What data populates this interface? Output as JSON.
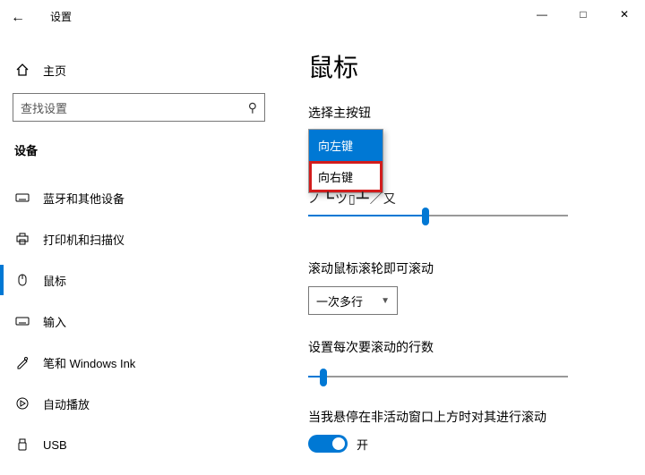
{
  "window": {
    "title": "设置"
  },
  "sidebar": {
    "home": "主页",
    "search_placeholder": "查找设置",
    "category": "设备",
    "items": [
      {
        "icon": "keyboard-icon",
        "label": "蓝牙和其他设备"
      },
      {
        "icon": "printer-icon",
        "label": "打印机和扫描仪"
      },
      {
        "icon": "mouse-icon",
        "label": "鼠标"
      },
      {
        "icon": "keyboard2-icon",
        "label": "输入"
      },
      {
        "icon": "pen-icon",
        "label": "笔和 Windows Ink"
      },
      {
        "icon": "autoplay-icon",
        "label": "自动播放"
      },
      {
        "icon": "usb-icon",
        "label": "USB"
      }
    ],
    "active_index": 2
  },
  "main": {
    "page_title": "鼠标",
    "primary_button": {
      "label": "选择主按钮",
      "options": [
        "向左键",
        "向右键"
      ],
      "selected_index": 0,
      "highlighted_index": 1
    },
    "cursor_speed": {
      "label_truncated": "光标速度",
      "value_percent": 45
    },
    "scroll_mode": {
      "label": "滚动鼠标滚轮即可滚动",
      "value": "一次多行"
    },
    "lines_per_scroll": {
      "label": "设置每次要滚动的行数",
      "value_percent": 6
    },
    "inactive_hover": {
      "label": "当我悬停在非活动窗口上方时对其进行滚动",
      "state_label": "开",
      "on": true
    }
  }
}
